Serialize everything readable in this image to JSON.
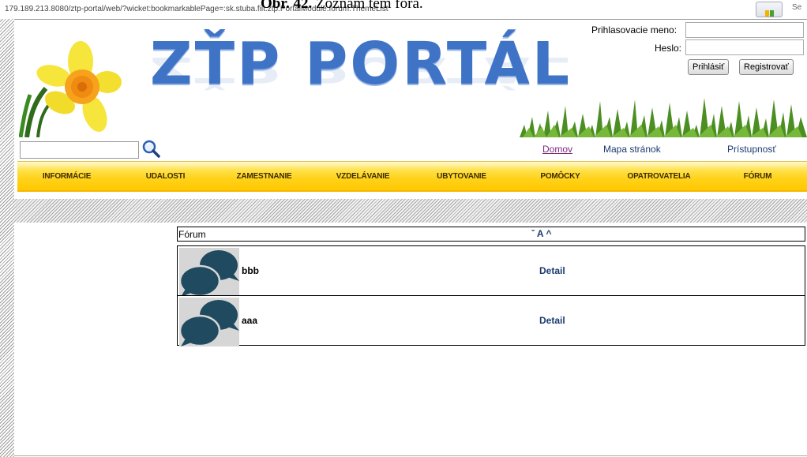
{
  "browser": {
    "url": "179.189.213.8080/ztp-portal/web/?wicket:bookmarkablePage=:sk.stuba.fiit.ztp.PortalModule.forum.ThemeList",
    "tab_cut": "Se"
  },
  "caption": {
    "label": "Obr. 42.",
    "text": "Zoznam tém fóra."
  },
  "header": {
    "logo_text": "ZŤP PORTÁL"
  },
  "login": {
    "username_label": "Prihlasovacie meno:",
    "password_label": "Heslo:",
    "username_value": "",
    "password_value": "",
    "login_button": "Prihlásiť",
    "register_button": "Registrovať"
  },
  "search": {
    "value": "",
    "icon": "search-icon"
  },
  "top_links": {
    "home": "Domov",
    "sitemap": "Mapa stránok",
    "accessibility": "Prístupnosť"
  },
  "nav": {
    "items": [
      {
        "label": "INFORMÁCIE"
      },
      {
        "label": "UDALOSTI"
      },
      {
        "label": "ZAMESTNANIE"
      },
      {
        "label": "VZDELÁVANIE"
      },
      {
        "label": "UBYTOVANIE"
      },
      {
        "label": "POMÔCKY"
      },
      {
        "label": "OPATROVATELIA"
      },
      {
        "label": "FÓRUM"
      }
    ]
  },
  "forum": {
    "header_title": "Fórum",
    "sort_desc": "ˇ",
    "sort_label": "A",
    "sort_asc": "^",
    "rows": [
      {
        "name": "bbb",
        "detail": "Detail"
      },
      {
        "name": "aaa",
        "detail": "Detail"
      }
    ]
  },
  "colors": {
    "logo_blue": "#3f73c6",
    "nav_yellow": "#ffd21a",
    "link_visited": "#7b2a7b",
    "link_blue": "#1c3a6e",
    "forum_icon": "#1f4a60"
  }
}
